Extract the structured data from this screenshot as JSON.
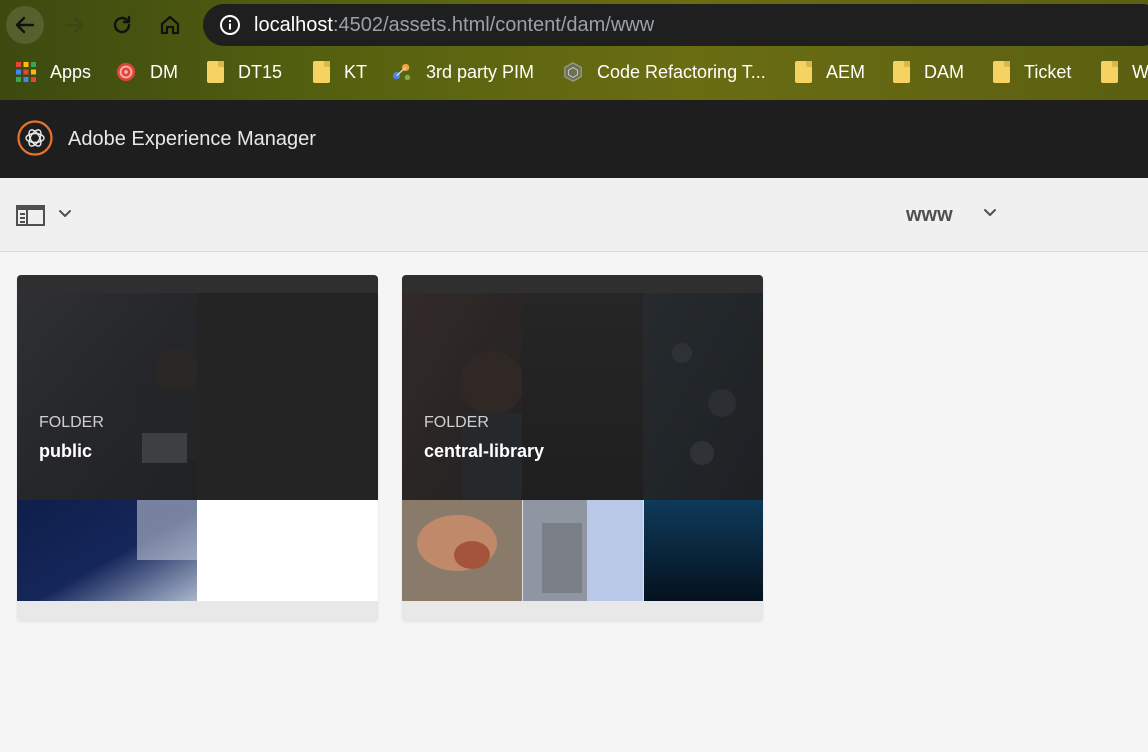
{
  "browser": {
    "url_host": "localhost",
    "url_rest": ":4502/assets.html/content/dam/www",
    "bookmarks": [
      {
        "label": "Apps",
        "icon": "apps-grid-icon"
      },
      {
        "label": "DM",
        "icon": "dm-icon"
      },
      {
        "label": "DT15",
        "icon": "folder-icon"
      },
      {
        "label": "KT",
        "icon": "folder-icon"
      },
      {
        "label": "3rd party PIM",
        "icon": "pim-icon"
      },
      {
        "label": "Code Refactoring T...",
        "icon": "code-refactoring-icon"
      },
      {
        "label": "AEM",
        "icon": "folder-icon"
      },
      {
        "label": "DAM",
        "icon": "folder-icon"
      },
      {
        "label": "Ticket",
        "icon": "folder-icon"
      },
      {
        "label": "W",
        "icon": "folder-icon"
      }
    ]
  },
  "aem": {
    "title": "Adobe Experience Manager"
  },
  "toolbar": {
    "breadcrumb": "www"
  },
  "cards": [
    {
      "type": "FOLDER",
      "name": "public"
    },
    {
      "type": "FOLDER",
      "name": "central-library"
    }
  ],
  "colors": {
    "aem_header": "#1e1e1e",
    "aem_logo_accent": "#e8742c",
    "toolbar_bg": "#f0f0f0",
    "content_bg": "#f5f5f5"
  }
}
